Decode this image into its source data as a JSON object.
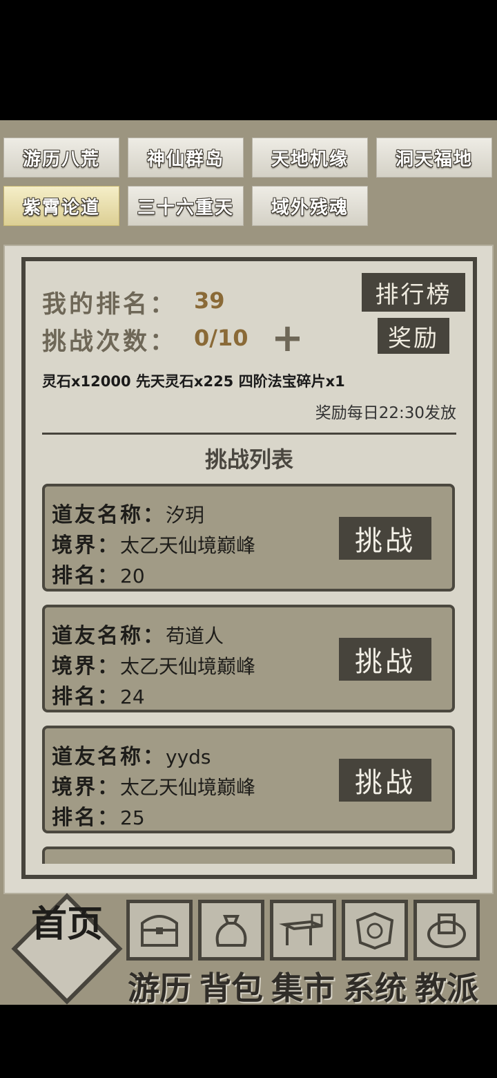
{
  "tabs": [
    {
      "label": "游历八荒"
    },
    {
      "label": "神仙群岛"
    },
    {
      "label": "天地机缘"
    },
    {
      "label": "洞天福地"
    },
    {
      "label": "紫霄论道"
    },
    {
      "label": "三十六重天"
    },
    {
      "label": "域外残魂"
    }
  ],
  "stats": {
    "rank_label": "我的排名：",
    "rank_value": "39",
    "challenges_label": "挑战次数：",
    "challenges_value": "0/10",
    "plus": "+"
  },
  "buttons": {
    "leaderboard": "排行榜",
    "reward": "奖励"
  },
  "reward": {
    "items": "灵石x12000 先天灵石x225 四阶法宝碎片x1",
    "schedule": "奖励每日22:30发放"
  },
  "challenge_list": {
    "title": "挑战列表",
    "name_label": "道友名称：",
    "realm_label": "境界：",
    "rank_label": "排名：",
    "button_label": "挑战",
    "entries": [
      {
        "name": "汐玥",
        "realm": "太乙天仙境巅峰",
        "rank": "20"
      },
      {
        "name": "苟道人",
        "realm": "太乙天仙境巅峰",
        "rank": "24"
      },
      {
        "name": "yyds",
        "realm": "太乙天仙境巅峰",
        "rank": "25"
      }
    ]
  },
  "bottom_nav": {
    "home": "首页",
    "items": [
      {
        "label": "游历",
        "icon": "chest-icon"
      },
      {
        "label": "背包",
        "icon": "bag-icon"
      },
      {
        "label": "集市",
        "icon": "market-stall-icon"
      },
      {
        "label": "系统",
        "icon": "system-badge-icon"
      },
      {
        "label": "教派",
        "icon": "sect-seal-icon"
      }
    ]
  }
}
